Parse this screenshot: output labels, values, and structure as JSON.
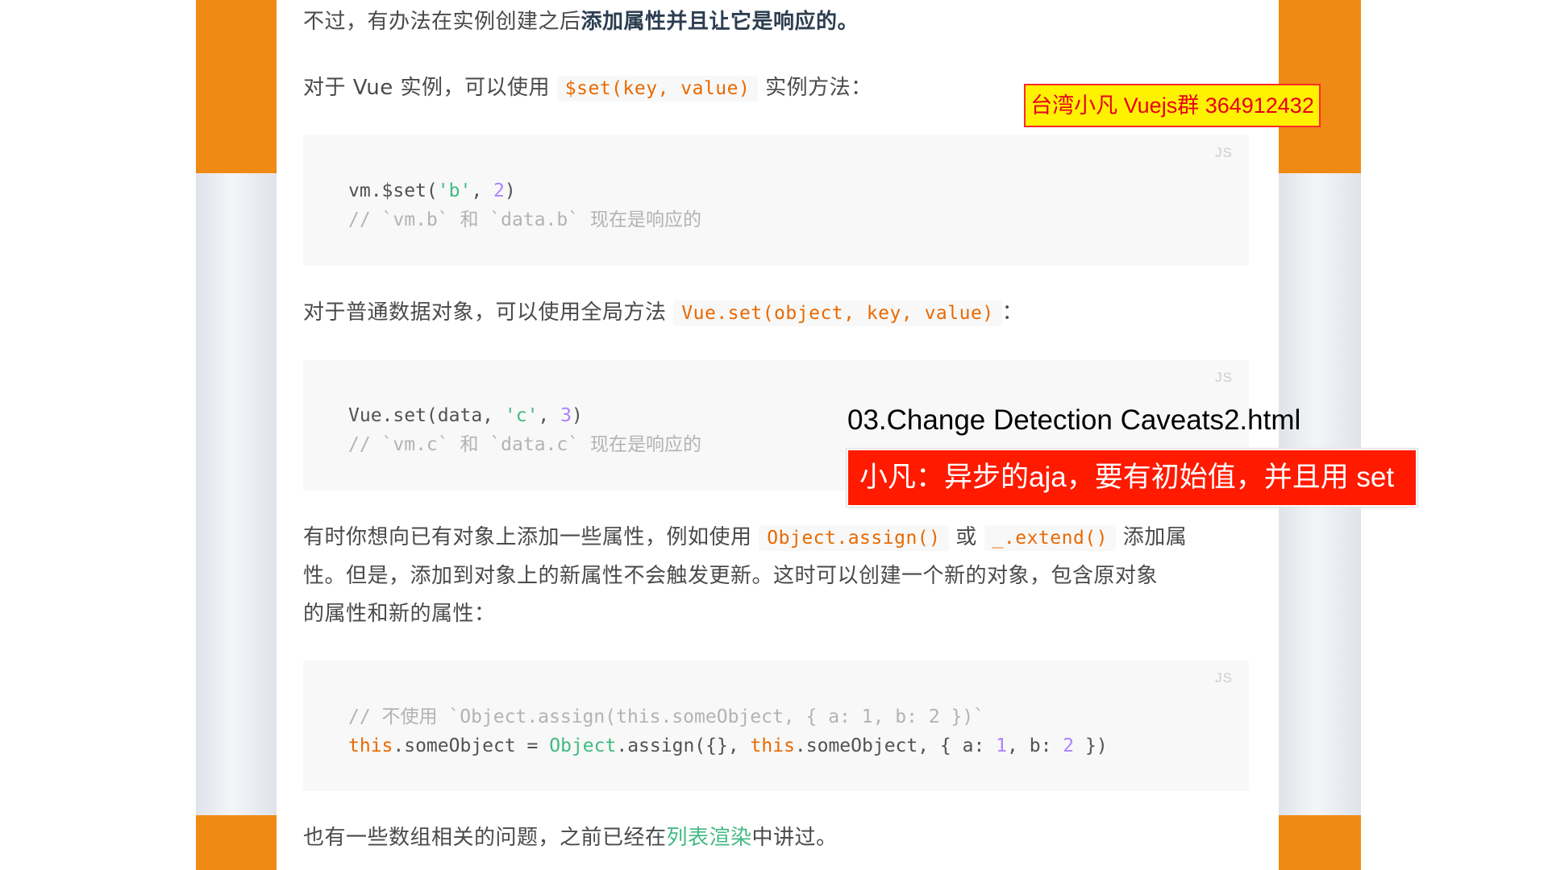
{
  "intro": {
    "p1_plain": "不过，有办法在实例创建之后",
    "p1_bold": "添加属性并且让它是响应的。",
    "p2_prefix": "对于 Vue 实例，可以使用",
    "p2_code": "$set(key, value)",
    "p2_suffix": "实例方法："
  },
  "code1": {
    "lang": "JS",
    "line1_a": "vm.$set(",
    "line1_str": "'b'",
    "line1_b": ", ",
    "line1_num": "2",
    "line1_c": ")",
    "line2": "// `vm.b` 和 `data.b` 现在是响应的"
  },
  "p3": {
    "prefix": "对于普通数据对象，可以使用全局方法",
    "code": "Vue.set(object, key, value)",
    "suffix": "："
  },
  "code2": {
    "lang": "JS",
    "line1_a": "Vue.set(data, ",
    "line1_str": "'c'",
    "line1_b": ", ",
    "line1_num": "3",
    "line1_c": ")",
    "line2": "// `vm.c` 和 `data.c` 现在是响应的"
  },
  "p4": {
    "prefix": "有时你想向已有对象上添加一些属性，例如使用",
    "code1": "Object.assign()",
    "mid": "或",
    "code2": "_.extend()",
    "suffix": "添加属",
    "line2": "性。但是，添加到对象上的新属性不会触发更新。这时可以创建一个新的对象，包含原对象",
    "line3": "的属性和新的属性："
  },
  "code3": {
    "lang": "JS",
    "line1": "// 不使用 `Object.assign(this.someObject, { a: 1, b: 2 })`",
    "l2_this1": "this",
    "l2_a": ".someObject = ",
    "l2_obj": "Object",
    "l2_b": ".assign({}, ",
    "l2_this2": "this",
    "l2_c": ".someObject, { a: ",
    "l2_n1": "1",
    "l2_d": ", b: ",
    "l2_n2": "2",
    "l2_e": " })"
  },
  "p5": {
    "prefix": "也有一些数组相关的问题，之前已经在",
    "link": "列表渲染",
    "suffix": "中讲过。"
  },
  "overlay": {
    "badge": "台湾小凡 Vuejs群 364912432",
    "filename": "03.Change Detection Caveats2.html",
    "banner": "小凡：异步的aja，要有初始值，并且用 set"
  }
}
